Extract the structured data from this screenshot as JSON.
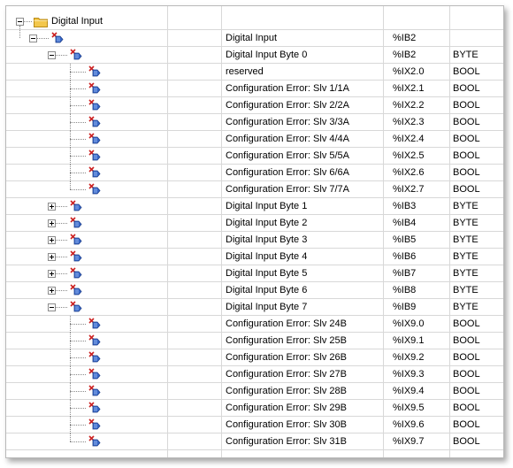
{
  "tree": {
    "root_label": "Digital Input",
    "rows": [
      {
        "level": 1,
        "expander": "minus",
        "name": "Digital Input",
        "address": "%IB2",
        "type": ""
      },
      {
        "level": 2,
        "expander": "minus",
        "name": "Digital Input Byte 0",
        "address": "%IB2",
        "type": "BYTE"
      },
      {
        "level": 3,
        "expander": "none",
        "name": "reserved",
        "address": "%IX2.0",
        "type": "BOOL"
      },
      {
        "level": 3,
        "expander": "none",
        "name": "Configuration Error: Slv 1/1A",
        "address": "%IX2.1",
        "type": "BOOL"
      },
      {
        "level": 3,
        "expander": "none",
        "name": "Configuration Error: Slv 2/2A",
        "address": "%IX2.2",
        "type": "BOOL"
      },
      {
        "level": 3,
        "expander": "none",
        "name": "Configuration Error: Slv 3/3A",
        "address": "%IX2.3",
        "type": "BOOL"
      },
      {
        "level": 3,
        "expander": "none",
        "name": "Configuration Error: Slv 4/4A",
        "address": "%IX2.4",
        "type": "BOOL"
      },
      {
        "level": 3,
        "expander": "none",
        "name": "Configuration Error: Slv 5/5A",
        "address": "%IX2.5",
        "type": "BOOL"
      },
      {
        "level": 3,
        "expander": "none",
        "name": "Configuration Error: Slv 6/6A",
        "address": "%IX2.6",
        "type": "BOOL"
      },
      {
        "level": 3,
        "expander": "none",
        "name": "Configuration Error: Slv 7/7A",
        "address": "%IX2.7",
        "type": "BOOL"
      },
      {
        "level": 2,
        "expander": "plus",
        "name": "Digital Input Byte 1",
        "address": "%IB3",
        "type": "BYTE"
      },
      {
        "level": 2,
        "expander": "plus",
        "name": "Digital Input Byte 2",
        "address": "%IB4",
        "type": "BYTE"
      },
      {
        "level": 2,
        "expander": "plus",
        "name": "Digital Input Byte 3",
        "address": "%IB5",
        "type": "BYTE"
      },
      {
        "level": 2,
        "expander": "plus",
        "name": "Digital Input Byte 4",
        "address": "%IB6",
        "type": "BYTE"
      },
      {
        "level": 2,
        "expander": "plus",
        "name": "Digital Input Byte 5",
        "address": "%IB7",
        "type": "BYTE"
      },
      {
        "level": 2,
        "expander": "plus",
        "name": "Digital Input Byte 6",
        "address": "%IB8",
        "type": "BYTE"
      },
      {
        "level": 2,
        "expander": "minus",
        "name": "Digital Input Byte 7",
        "address": "%IB9",
        "type": "BYTE"
      },
      {
        "level": 3,
        "expander": "none",
        "name": "Configuration Error: Slv 24B",
        "address": "%IX9.0",
        "type": "BOOL"
      },
      {
        "level": 3,
        "expander": "none",
        "name": "Configuration Error: Slv 25B",
        "address": "%IX9.1",
        "type": "BOOL"
      },
      {
        "level": 3,
        "expander": "none",
        "name": "Configuration Error: Slv 26B",
        "address": "%IX9.2",
        "type": "BOOL"
      },
      {
        "level": 3,
        "expander": "none",
        "name": "Configuration Error: Slv 27B",
        "address": "%IX9.3",
        "type": "BOOL"
      },
      {
        "level": 3,
        "expander": "none",
        "name": "Configuration Error: Slv 28B",
        "address": "%IX9.4",
        "type": "BOOL"
      },
      {
        "level": 3,
        "expander": "none",
        "name": "Configuration Error: Slv 29B",
        "address": "%IX9.5",
        "type": "BOOL"
      },
      {
        "level": 3,
        "expander": "none",
        "name": "Configuration Error: Slv 30B",
        "address": "%IX9.6",
        "type": "BOOL"
      },
      {
        "level": 3,
        "expander": "none",
        "name": "Configuration Error: Slv 31B",
        "address": "%IX9.7",
        "type": "BOOL"
      }
    ]
  },
  "icons": {
    "root": "folder-icon",
    "node": "io-channel-icon",
    "expand": "plus-expander-icon",
    "collapse": "minus-expander-icon"
  },
  "colors": {
    "grid_line": "#d8d8d8",
    "folder": "#f3c74c",
    "channel_icon_red": "#cc2222",
    "channel_icon_blue": "#3566c8"
  }
}
